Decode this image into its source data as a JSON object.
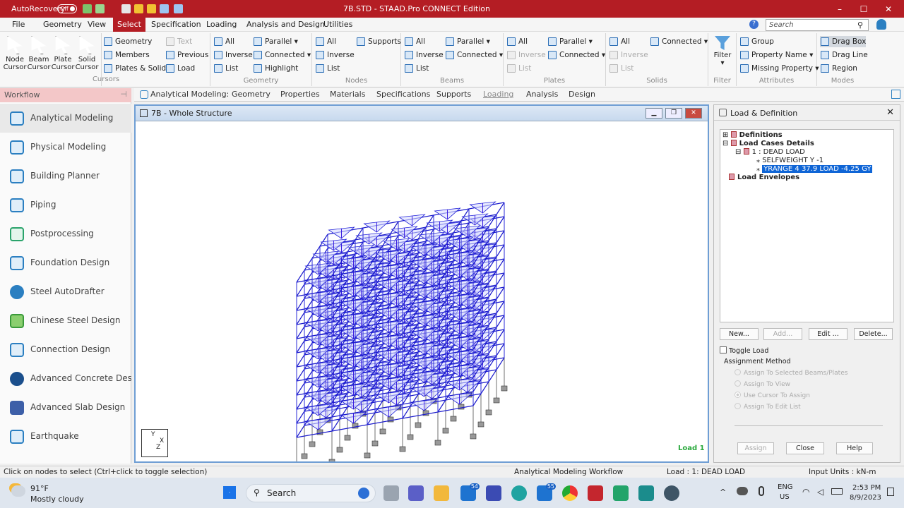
{
  "titlebar": {
    "autorecovery": "AutoRecovery",
    "toggle": "Off",
    "title": "7B.STD - STAAD.Pro CONNECT Edition",
    "minimize": "–",
    "maximize": "☐",
    "close": "✕"
  },
  "menu": {
    "tabs": [
      "File",
      "Geometry",
      "View",
      "Select",
      "Specification",
      "Loading",
      "Analysis and Design",
      "Utilities"
    ],
    "active": "Select",
    "search_placeholder": "Search"
  },
  "ribbon": {
    "cursors": {
      "label": "Cursors",
      "node": "Node\nCursor",
      "beam": "Beam\nCursor",
      "plate": "Plate\nCursor",
      "solid": "Solid\nCursor"
    },
    "geometry": {
      "label": "Geometry",
      "items": [
        "Geometry",
        "Members",
        "Plates & Solids",
        "Text",
        "Previous",
        "Load",
        "All",
        "Inverse",
        "List",
        "Parallel",
        "Connected",
        "Highlight"
      ]
    },
    "nodes": {
      "label": "Nodes",
      "items": [
        "All",
        "Inverse",
        "List",
        "Supports"
      ]
    },
    "beams": {
      "label": "Beams",
      "items": [
        "All",
        "Inverse",
        "List",
        "Parallel",
        "Connected"
      ]
    },
    "plates": {
      "label": "Plates",
      "items": [
        "All",
        "Inverse",
        "List",
        "Parallel",
        "Connected"
      ]
    },
    "solids": {
      "label": "Solids",
      "items": [
        "All",
        "Inverse",
        "List",
        "Connected"
      ]
    },
    "filter": {
      "label": "Filter",
      "button": "Filter"
    },
    "attributes": {
      "label": "Attributes",
      "items": [
        "Group",
        "Property Name",
        "Missing Property"
      ]
    },
    "modes": {
      "label": "Modes",
      "items": [
        "Drag Box",
        "Drag Line",
        "Region"
      ]
    }
  },
  "workflow": {
    "header": "Workflow",
    "items": [
      "Analytical Modeling",
      "Physical Modeling",
      "Building Planner",
      "Piping",
      "Postprocessing",
      "Foundation Design",
      "Steel AutoDrafter",
      "Chinese Steel Design",
      "Connection Design",
      "Advanced Concrete Desi...",
      "Advanced Slab Design",
      "Earthquake"
    ]
  },
  "pagetabs": {
    "title": "Analytical Modeling:",
    "tabs": [
      "Geometry",
      "Properties",
      "Materials",
      "Specifications",
      "Supports",
      "Loading",
      "Analysis",
      "Design"
    ]
  },
  "viewport": {
    "title": "7B - Whole Structure",
    "load_label": "Load 1",
    "axis_y": "Y",
    "axis_x": "X",
    "axis_z": "Z"
  },
  "loadpanel": {
    "title": "Load & Definition",
    "tree": {
      "definitions": "Definitions",
      "load_cases": "Load Cases Details",
      "case1": "1 : DEAD LOAD",
      "selfweight": "SELFWEIGHT Y -1",
      "yrange": "YRANGE 4 37.9 LOAD -4.25 GY",
      "envelopes": "Load Envelopes"
    },
    "buttons": {
      "new": "New...",
      "add": "Add...",
      "edit": "Edit ...",
      "delete": "Delete..."
    },
    "toggle_load": "Toggle Load",
    "assignment_method": "Assignment Method",
    "options": [
      "Assign To Selected Beams/Plates",
      "Assign To View",
      "Use Cursor To Assign",
      "Assign To Edit List"
    ],
    "bottom": {
      "assign": "Assign",
      "close": "Close",
      "help": "Help"
    }
  },
  "status": {
    "hint": "Click on nodes to select (Ctrl+click to toggle selection)",
    "workflow": "Analytical Modeling Workflow",
    "load": "Load : 1: DEAD LOAD",
    "units": "Input Units : kN-m"
  },
  "taskbar": {
    "temp": "91°F",
    "weather": "Mostly cloudy",
    "search": "Search",
    "lang1": "ENG",
    "lang2": "US",
    "time": "2:53 PM",
    "date": "8/9/2023",
    "badge1": "54",
    "badge2": "55"
  }
}
